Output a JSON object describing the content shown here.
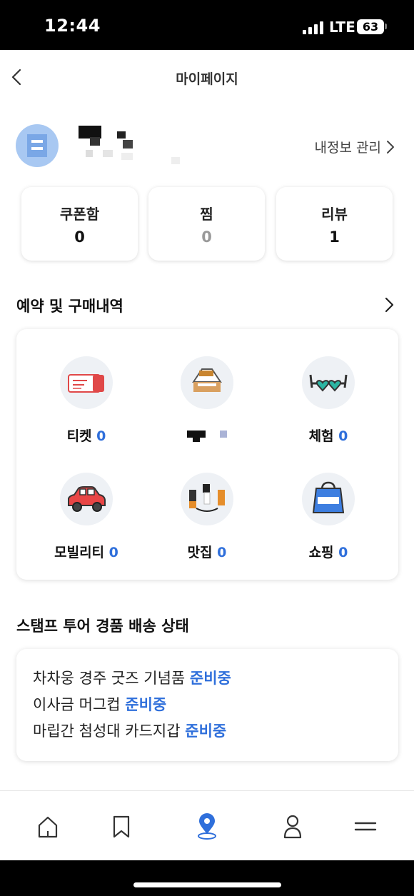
{
  "status_bar": {
    "time": "12:44",
    "network": "LTE",
    "battery": "63"
  },
  "header": {
    "title": "마이페이지",
    "back_icon": "chevron-left-icon"
  },
  "profile": {
    "manage_label": "내정보 관리"
  },
  "stats": [
    {
      "label": "쿠폰함",
      "value": "0"
    },
    {
      "label": "찜",
      "value": "0"
    },
    {
      "label": "리뷰",
      "value": "1"
    }
  ],
  "booking": {
    "title": "예약 및 구매내역",
    "categories": [
      {
        "label": "티켓",
        "count": "0",
        "icon": "ticket-icon"
      },
      {
        "label": "",
        "count": "",
        "icon": "lodging-icon"
      },
      {
        "label": "체험",
        "count": "0",
        "icon": "sunglasses-icon"
      },
      {
        "label": "모빌리티",
        "count": "0",
        "icon": "car-icon"
      },
      {
        "label": "맛집",
        "count": "0",
        "icon": "restaurant-icon"
      },
      {
        "label": "쇼핑",
        "count": "0",
        "icon": "shopping-bag-icon"
      }
    ]
  },
  "stamp_tour": {
    "title": "스탬프 투어 경품 배송 상태",
    "items": [
      {
        "name": "차차웅 경주 굿즈 기념품",
        "status": "준비중"
      },
      {
        "name": "이사금 머그컵",
        "status": "준비중"
      },
      {
        "name": "마립간 첨성대 카드지갑",
        "status": "준비중"
      }
    ]
  },
  "tab_bar": {
    "tabs": [
      {
        "icon": "home-icon"
      },
      {
        "icon": "bookmark-icon"
      },
      {
        "icon": "location-pin-icon"
      },
      {
        "icon": "person-icon"
      },
      {
        "icon": "menu-icon"
      }
    ]
  },
  "colors": {
    "accent": "#2f6fdb",
    "card_bg": "#ffffff",
    "icon_bg": "#eef1f5"
  }
}
